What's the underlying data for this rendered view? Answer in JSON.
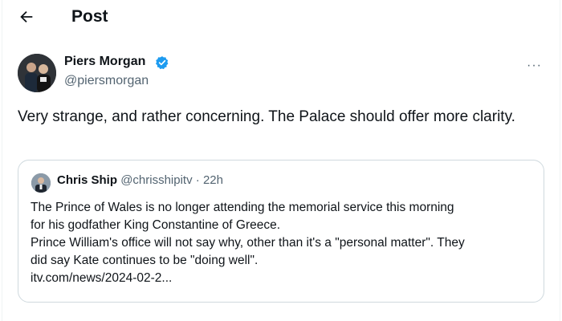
{
  "header": {
    "back_icon": "back-arrow-icon",
    "title": "Post"
  },
  "author": {
    "name": "Piers Morgan",
    "handle": "@piersmorgan",
    "verified_color": "#1d9bf0"
  },
  "post": {
    "text": "Very strange, and rather concerning. The Palace should offer more clarity."
  },
  "quote": {
    "name": "Chris Ship",
    "handle": "@chrisshipitv",
    "separator": "·",
    "time": "22h",
    "lines": [
      "The Prince of Wales is no longer attending the memorial service this morning",
      "for his godfather King Constantine of Greece.",
      "Prince William's office will not say why, other than it's a \"personal matter\". They",
      "did say Kate continues to be \"doing well\".",
      "itv.com/news/2024-02-2..."
    ]
  },
  "colors": {
    "text": "#0f1419",
    "secondary": "#536471",
    "border": "#cfd9de",
    "accent": "#1d9bf0"
  }
}
